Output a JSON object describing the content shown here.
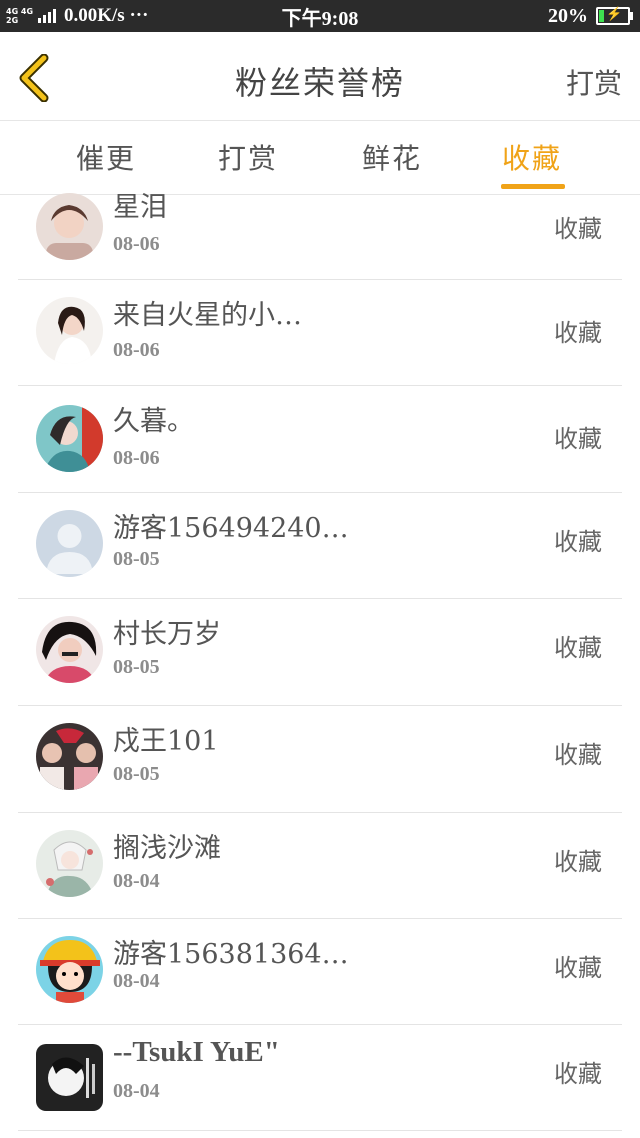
{
  "status_bar": {
    "network": "4G 4G 2G",
    "speed": "0.00K/s ···",
    "time": "下午9:08",
    "battery_percent": "20%",
    "battery_level": 0.2
  },
  "header": {
    "back_icon": "chevron-left-icon",
    "title": "粉丝荣誉榜",
    "right_label": "打赏"
  },
  "tabs": [
    {
      "label": "催更",
      "active": false
    },
    {
      "label": "打赏",
      "active": false
    },
    {
      "label": "鲜花",
      "active": false
    },
    {
      "label": "收藏",
      "active": true
    }
  ],
  "colors": {
    "accent": "#f0a318",
    "text": "#555555",
    "date": "#8c8c8c",
    "divider": "#e4e4e4"
  },
  "entries": [
    {
      "name": "星泪",
      "date": "08-06",
      "action": "收藏",
      "avatar": "photo-portrait"
    },
    {
      "name": "来自火星的小…",
      "date": "08-06",
      "action": "收藏",
      "avatar": "photo-portrait"
    },
    {
      "name": "久暮。",
      "date": "08-06",
      "action": "收藏",
      "avatar": "photo-anime"
    },
    {
      "name": "游客156494240…",
      "date": "08-05",
      "action": "收藏",
      "avatar": "default-user-icon"
    },
    {
      "name": "村长万岁",
      "date": "08-05",
      "action": "收藏",
      "avatar": "photo-portrait"
    },
    {
      "name": "戍王101",
      "date": "08-05",
      "action": "收藏",
      "avatar": "photo-group"
    },
    {
      "name": "搁浅沙滩",
      "date": "08-04",
      "action": "收藏",
      "avatar": "photo-anime"
    },
    {
      "name": "游客156381364…",
      "date": "08-04",
      "action": "收藏",
      "avatar": "cartoon-girl"
    },
    {
      "name": "--TsukI YuE\"",
      "date": "08-04",
      "action": "收藏",
      "avatar": "photo-bw"
    }
  ]
}
